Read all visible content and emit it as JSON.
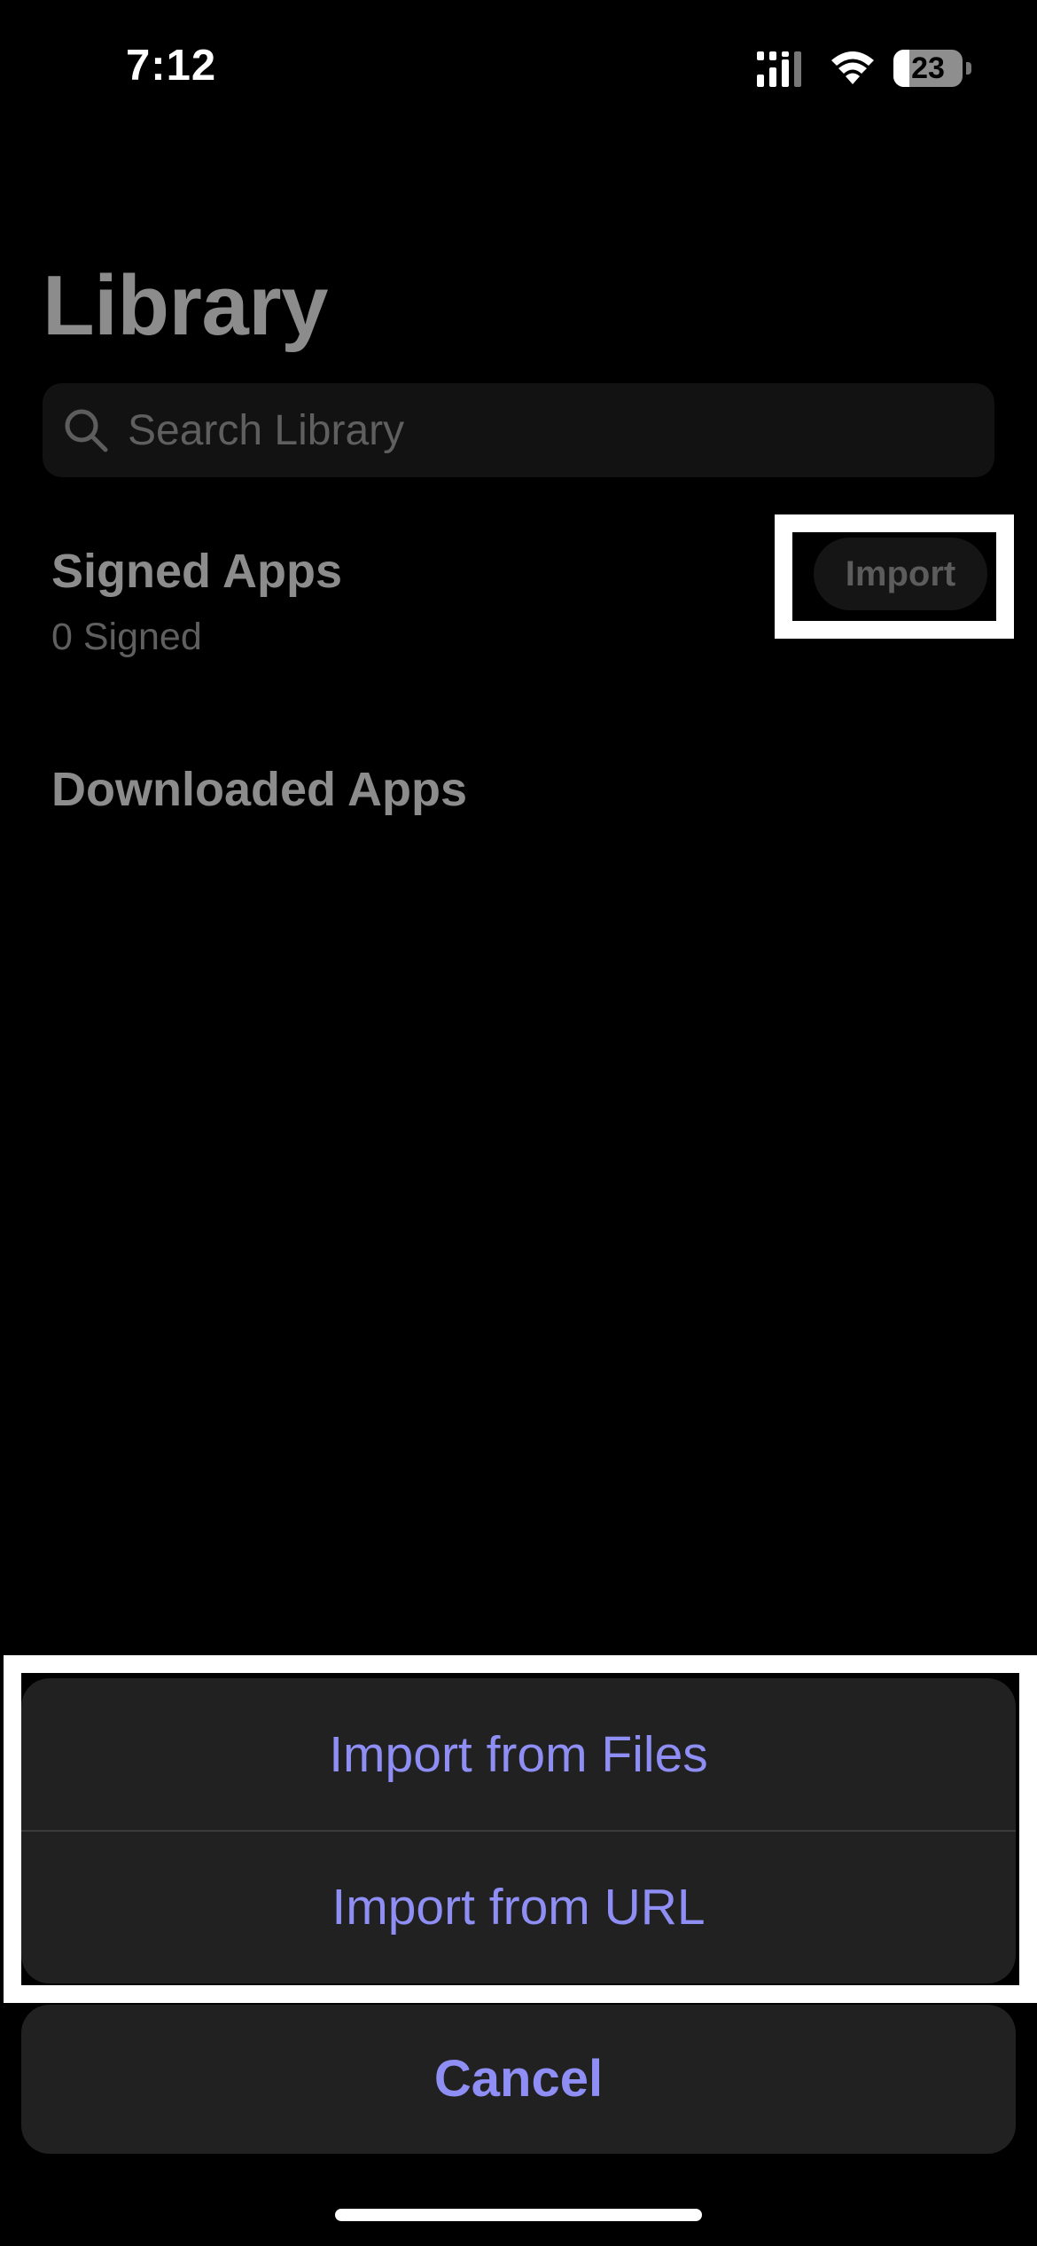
{
  "status_bar": {
    "time": "7:12",
    "battery_level": "23",
    "battery_fraction": 0.23,
    "icons": [
      "signal-icon",
      "wifi-icon",
      "battery-icon"
    ]
  },
  "library": {
    "title": "Library",
    "search": {
      "placeholder": "Search Library",
      "value": ""
    },
    "signed_apps": {
      "title": "Signed Apps",
      "subtitle": "0 Signed",
      "import_label": "Import"
    },
    "downloaded_apps": {
      "title": "Downloaded Apps"
    }
  },
  "action_sheet": {
    "items": [
      {
        "label": "Import from Files"
      },
      {
        "label": "Import from URL"
      }
    ],
    "cancel_label": "Cancel",
    "accent_color": "#8E8EF5"
  },
  "colors": {
    "background": "#000000",
    "sheet": "#212121",
    "highlight": "#FFFFFF"
  }
}
